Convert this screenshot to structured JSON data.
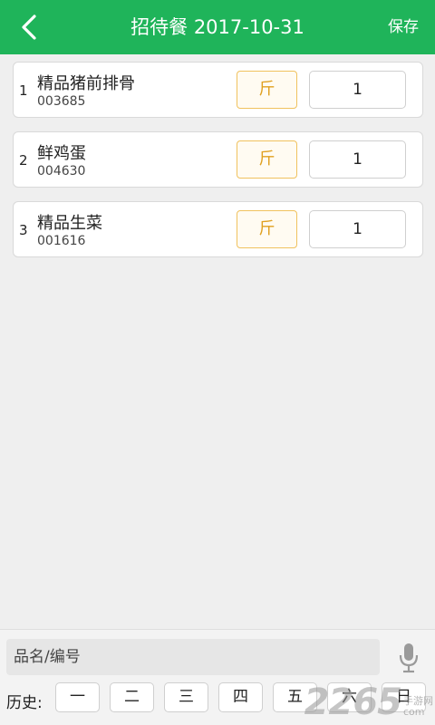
{
  "header": {
    "title": "招待餐 2017-10-31",
    "save_label": "保存",
    "back_icon": "chevron-left-icon"
  },
  "items": [
    {
      "index": "1",
      "name": "精品猪前排骨",
      "code": "003685",
      "unit": "斤",
      "qty": "1"
    },
    {
      "index": "2",
      "name": "鲜鸡蛋",
      "code": "004630",
      "unit": "斤",
      "qty": "1"
    },
    {
      "index": "3",
      "name": "精品生菜",
      "code": "001616",
      "unit": "斤",
      "qty": "1"
    }
  ],
  "search": {
    "placeholder": "品名/编号",
    "value": "",
    "mic_icon": "microphone-icon"
  },
  "history": {
    "label": "历史:",
    "days": [
      "一",
      "二",
      "三",
      "四",
      "五",
      "六",
      "日"
    ]
  },
  "watermark": {
    "number": "2265",
    "sub": [
      "手游网",
      "com"
    ]
  },
  "colors": {
    "accent": "#1fb45a",
    "unit_border": "#f0c25e",
    "unit_text": "#e0a020"
  }
}
